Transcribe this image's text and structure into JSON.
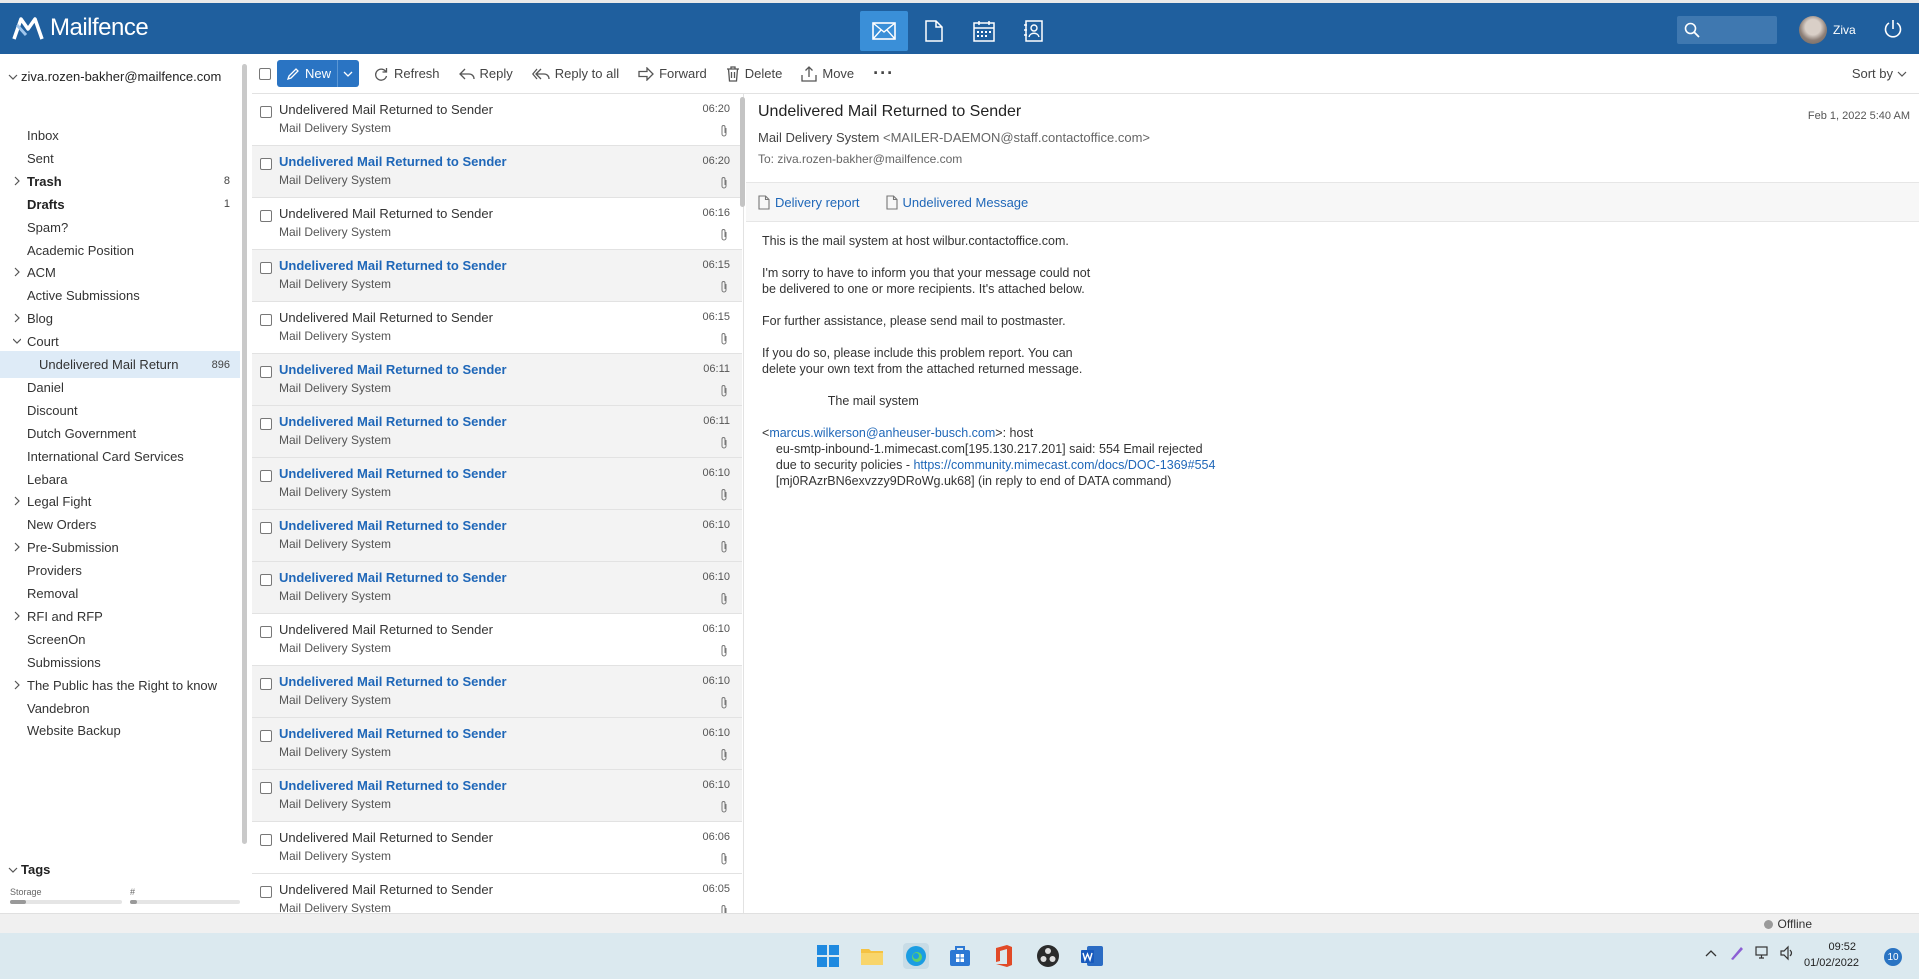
{
  "header": {
    "app_name": "Mailfence",
    "user_name": "Ziva",
    "apps": [
      "mail-icon",
      "document-icon",
      "calendar-icon",
      "contacts-icon"
    ]
  },
  "sidebar": {
    "account": "ziva.rozen-bakher@mailfence.com",
    "folders": [
      {
        "label": "Inbox",
        "count": "",
        "expandable": false,
        "bold": false
      },
      {
        "label": "Sent",
        "count": "",
        "expandable": false,
        "bold": false
      },
      {
        "label": "Trash",
        "count": "8",
        "expandable": true,
        "bold": true
      },
      {
        "label": "Drafts",
        "count": "1",
        "expandable": false,
        "bold": true
      },
      {
        "label": "Spam?",
        "count": "",
        "expandable": false,
        "bold": false
      },
      {
        "label": "Academic Position",
        "count": "",
        "expandable": false,
        "bold": false
      },
      {
        "label": "ACM",
        "count": "",
        "expandable": true,
        "bold": false
      },
      {
        "label": "Active Submissions",
        "count": "",
        "expandable": false,
        "bold": false
      },
      {
        "label": "Blog",
        "count": "",
        "expandable": true,
        "bold": false
      },
      {
        "label": "Court",
        "count": "",
        "expandable": true,
        "bold": false,
        "expanded": true
      },
      {
        "label": "Undelivered Mail Return",
        "count": "896",
        "expandable": false,
        "bold": false,
        "sub": true,
        "selected": true
      },
      {
        "label": "Daniel",
        "count": "",
        "expandable": false,
        "bold": false
      },
      {
        "label": "Discount",
        "count": "",
        "expandable": false,
        "bold": false
      },
      {
        "label": "Dutch Government",
        "count": "",
        "expandable": false,
        "bold": false
      },
      {
        "label": "International Card Services",
        "count": "",
        "expandable": false,
        "bold": false
      },
      {
        "label": "Lebara",
        "count": "",
        "expandable": false,
        "bold": false
      },
      {
        "label": "Legal Fight",
        "count": "",
        "expandable": true,
        "bold": false
      },
      {
        "label": "New Orders",
        "count": "",
        "expandable": false,
        "bold": false
      },
      {
        "label": "Pre-Submission",
        "count": "",
        "expandable": true,
        "bold": false
      },
      {
        "label": "Providers",
        "count": "",
        "expandable": false,
        "bold": false
      },
      {
        "label": "Removal",
        "count": "",
        "expandable": false,
        "bold": false
      },
      {
        "label": "RFI and RFP",
        "count": "",
        "expandable": true,
        "bold": false
      },
      {
        "label": "ScreenOn",
        "count": "",
        "expandable": false,
        "bold": false
      },
      {
        "label": "Submissions",
        "count": "",
        "expandable": false,
        "bold": false
      },
      {
        "label": "The Public has the Right to know",
        "count": "",
        "expandable": true,
        "bold": false
      },
      {
        "label": "Vandebron",
        "count": "",
        "expandable": false,
        "bold": false
      },
      {
        "label": "Website Backup",
        "count": "",
        "expandable": false,
        "bold": false
      }
    ],
    "tags_label": "Tags",
    "storage_label": "Storage",
    "count_label": "#",
    "storage_fraction": 0.14,
    "count_fraction": 0.06
  },
  "toolbar": {
    "new": "New",
    "refresh": "Refresh",
    "reply": "Reply",
    "reply_all": "Reply to all",
    "forward": "Forward",
    "delete": "Delete",
    "move": "Move",
    "more": "···",
    "sort_by": "Sort by"
  },
  "messages": [
    {
      "subject": "Undelivered Mail Returned to Sender",
      "from": "Mail Delivery System",
      "time": "06:20",
      "unread": false
    },
    {
      "subject": "Undelivered Mail Returned to Sender",
      "from": "Mail Delivery System",
      "time": "06:20",
      "unread": true
    },
    {
      "subject": "Undelivered Mail Returned to Sender",
      "from": "Mail Delivery System",
      "time": "06:16",
      "unread": false
    },
    {
      "subject": "Undelivered Mail Returned to Sender",
      "from": "Mail Delivery System",
      "time": "06:15",
      "unread": true
    },
    {
      "subject": "Undelivered Mail Returned to Sender",
      "from": "Mail Delivery System",
      "time": "06:15",
      "unread": false
    },
    {
      "subject": "Undelivered Mail Returned to Sender",
      "from": "Mail Delivery System",
      "time": "06:11",
      "unread": true
    },
    {
      "subject": "Undelivered Mail Returned to Sender",
      "from": "Mail Delivery System",
      "time": "06:11",
      "unread": true
    },
    {
      "subject": "Undelivered Mail Returned to Sender",
      "from": "Mail Delivery System",
      "time": "06:10",
      "unread": true
    },
    {
      "subject": "Undelivered Mail Returned to Sender",
      "from": "Mail Delivery System",
      "time": "06:10",
      "unread": true
    },
    {
      "subject": "Undelivered Mail Returned to Sender",
      "from": "Mail Delivery System",
      "time": "06:10",
      "unread": true
    },
    {
      "subject": "Undelivered Mail Returned to Sender",
      "from": "Mail Delivery System",
      "time": "06:10",
      "unread": false
    },
    {
      "subject": "Undelivered Mail Returned to Sender",
      "from": "Mail Delivery System",
      "time": "06:10",
      "unread": true
    },
    {
      "subject": "Undelivered Mail Returned to Sender",
      "from": "Mail Delivery System",
      "time": "06:10",
      "unread": true
    },
    {
      "subject": "Undelivered Mail Returned to Sender",
      "from": "Mail Delivery System",
      "time": "06:10",
      "unread": true
    },
    {
      "subject": "Undelivered Mail Returned to Sender",
      "from": "Mail Delivery System",
      "time": "06:06",
      "unread": false
    },
    {
      "subject": "Undelivered Mail Returned to Sender",
      "from": "Mail Delivery System",
      "time": "06:05",
      "unread": false
    }
  ],
  "reader": {
    "subject": "Undelivered Mail Returned to Sender",
    "date": "Feb 1, 2022 5:40 AM",
    "from_name": "Mail Delivery System",
    "from_addr": "<MAILER-DAEMON@staff.contactoffice.com>",
    "to": "To: ziva.rozen-bakher@mailfence.com",
    "attachments": [
      "Delivery report",
      "Undelivered Message"
    ],
    "body_intro": "This is the mail system at host wilbur.contactoffice.com.\n\nI'm sorry to have to inform you that your message could not\nbe delivered to one or more recipients. It's attached below.\n\nFor further assistance, please send mail to postmaster.\n\nIf you do so, please include this problem report. You can\ndelete your own text from the attached returned message.\n\n                   The mail system\n\n",
    "body_lt": "<",
    "recipient_link": "marcus.wilkerson@anheuser-busch.com",
    "body_host": ">: host\n    eu-smtp-inbound-1.mimecast.com[195.130.217.201] said: 554 Email rejected\n    due to security policies - ",
    "policy_link": "https://community.mimecast.com/docs/DOC-1369#554",
    "body_end": "\n    [mj0RAzrBN6exvzzy9DRoWg.uk68] (in reply to end of DATA command)"
  },
  "status": {
    "offline": "Offline"
  },
  "taskbar": {
    "time": "09:52",
    "date": "01/02/2022",
    "notifications": "10"
  }
}
